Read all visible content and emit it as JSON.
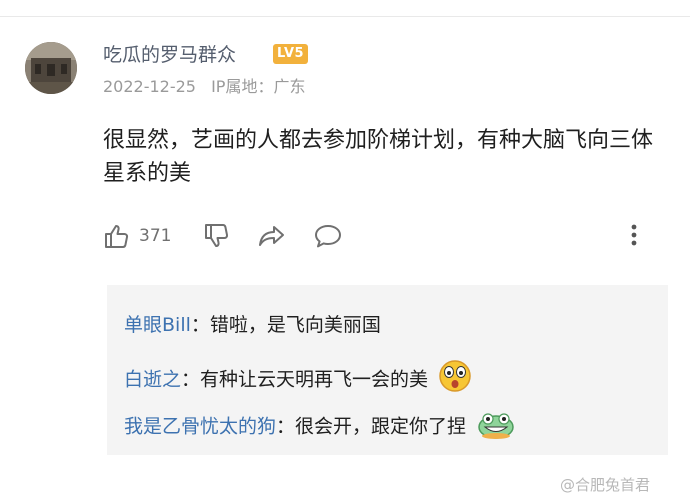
{
  "post": {
    "username": "吃瓜的罗马群众",
    "level_badge": "LV5",
    "date": "2022-12-25",
    "ip_location": "IP属地：广东",
    "comment_text": "很显然，艺画的人都去参加阶梯计划，有种大脑飞向三体星系的美",
    "like_count": "371"
  },
  "replies": [
    {
      "name": "单眼Bill",
      "text": "：错啦，是飞向美丽国",
      "emoji": ""
    },
    {
      "name": "白逝之",
      "text": "：有种让云天明再飞一会的美",
      "emoji": "surprised-face-emoji"
    },
    {
      "name": "我是乙骨忧太的狗",
      "text": "：很会开，跟定你了捏",
      "emoji": "grinning-cat-emoji"
    }
  ],
  "watermark": "@合肥兔首君",
  "icons": [
    "thumbs-up-icon",
    "thumbs-down-icon",
    "share-icon",
    "comment-icon",
    "more-vertical-icon"
  ],
  "colors": {
    "reply_name": "#3d72b0",
    "badge": "#f2b13c",
    "meta": "#9a9a9a"
  }
}
